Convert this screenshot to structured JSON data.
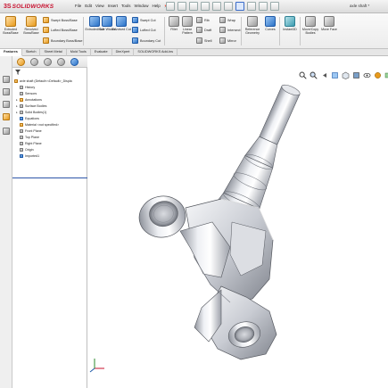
{
  "app": {
    "logo_ds": "3S",
    "logo_brand": "SOLIDWORKS",
    "filename": "axle shaft *"
  },
  "menu": [
    "File",
    "Edit",
    "View",
    "Insert",
    "Tools",
    "Window",
    "Help"
  ],
  "ribbon": {
    "extruded_boss": "Extruded Boss/Base",
    "revolved_boss": "Revolved Boss/Base",
    "swept_boss": "Swept Boss/Base",
    "lofted_boss": "Lofted Boss/Base",
    "boundary_boss": "Boundary Boss/Base",
    "extruded_cut": "Extruded Cut",
    "hole_wizard": "Hole Wizard",
    "revolved_cut": "Revolved Cut",
    "swept_cut": "Swept Cut",
    "lofted_cut": "Lofted Cut",
    "boundary_cut": "Boundary Cut",
    "fillet": "Fillet",
    "linear_pattern": "Linear Pattern",
    "rib": "Rib",
    "draft": "Draft",
    "shell": "Shell",
    "wrap": "Wrap",
    "intersect": "Intersect",
    "mirror": "Mirror",
    "reference_geometry": "Reference Geometry",
    "curves": "Curves",
    "instant3d": "Instant3D",
    "move_copy_bodies": "Move/Copy Bodies",
    "move_face": "Move Face"
  },
  "tabs": [
    "Features",
    "Sketch",
    "Sheet Metal",
    "Mold Tools",
    "Evaluate",
    "DimXpert",
    "SOLIDWORKS Add-Ins"
  ],
  "active_tab": "Features",
  "feature_tree": {
    "root": "axle shaft  (Default<<Default>_Displa",
    "items": [
      {
        "label": "History",
        "icon": "history-icon",
        "expandable": false
      },
      {
        "label": "Sensors",
        "icon": "sensor-icon",
        "expandable": false
      },
      {
        "label": "Annotations",
        "icon": "annotations-icon",
        "expandable": true
      },
      {
        "label": "Surface Bodies",
        "icon": "surface-bodies-icon",
        "expandable": true
      },
      {
        "label": "Solid Bodies(1)",
        "icon": "solid-bodies-icon",
        "expandable": true
      },
      {
        "label": "Equations",
        "icon": "equations-icon",
        "expandable": false
      },
      {
        "label": "Material <not specified>",
        "icon": "material-icon",
        "expandable": false
      },
      {
        "label": "Front Plane",
        "icon": "plane-icon",
        "expandable": false
      },
      {
        "label": "Top Plane",
        "icon": "plane-icon",
        "expandable": false
      },
      {
        "label": "Right Plane",
        "icon": "plane-icon",
        "expandable": false
      },
      {
        "label": "Origin",
        "icon": "origin-icon",
        "expandable": false
      },
      {
        "label": "Imported1",
        "icon": "imported-body-icon",
        "expandable": false
      }
    ]
  },
  "colors": {
    "brand_red": "#c8102e",
    "accent_blue": "#2a72c8",
    "selection_blue": "#3a6cc9"
  }
}
